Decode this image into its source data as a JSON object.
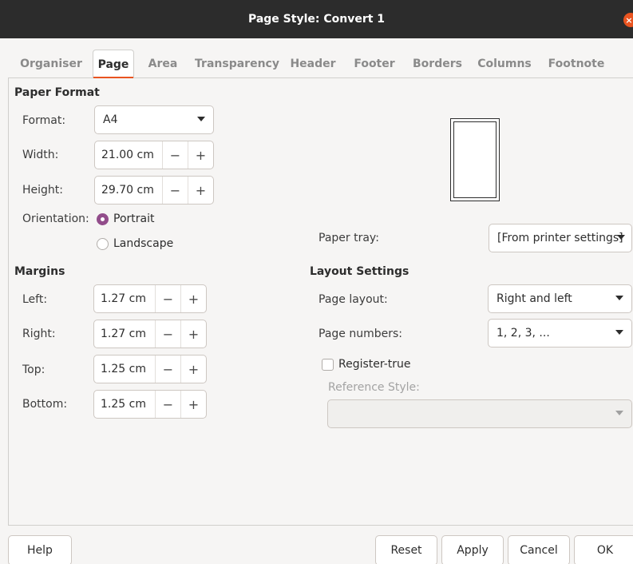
{
  "window": {
    "title": "Page Style: Convert 1",
    "close_glyph": "×"
  },
  "tabs": [
    {
      "label": "Organiser"
    },
    {
      "label": "Page"
    },
    {
      "label": "Area"
    },
    {
      "label": "Transparency"
    },
    {
      "label": "Header"
    },
    {
      "label": "Footer"
    },
    {
      "label": "Borders"
    },
    {
      "label": "Columns"
    },
    {
      "label": "Footnote"
    }
  ],
  "active_tab": "Page",
  "paper_format": {
    "title": "Paper Format",
    "format_label": "Format:",
    "format_value": "A4",
    "width_label": "Width:",
    "width_value": "21.00 cm",
    "height_label": "Height:",
    "height_value": "29.70 cm",
    "orientation_label": "Orientation:",
    "portrait_label": "Portrait",
    "landscape_label": "Landscape",
    "orientation_selected": "Portrait",
    "paper_tray_label": "Paper tray:",
    "paper_tray_value": "[From printer settings]"
  },
  "margins": {
    "title": "Margins",
    "left_label": "Left:",
    "left_value": "1.27 cm",
    "right_label": "Right:",
    "right_value": "1.27 cm",
    "top_label": "Top:",
    "top_value": "1.25 cm",
    "bottom_label": "Bottom:",
    "bottom_value": "1.25 cm"
  },
  "layout_settings": {
    "title": "Layout Settings",
    "page_layout_label": "Page layout:",
    "page_layout_value": "Right and left",
    "page_numbers_label": "Page numbers:",
    "page_numbers_value": "1, 2, 3, ...",
    "register_true_label": "Register-true",
    "register_true_checked": false,
    "reference_style_label": "Reference Style:",
    "reference_style_value": ""
  },
  "spin_glyphs": {
    "minus": "−",
    "plus": "+"
  },
  "buttons": {
    "help": "Help",
    "reset": "Reset",
    "apply": "Apply",
    "cancel": "Cancel",
    "ok": "OK"
  },
  "colors": {
    "accent": "#e95420",
    "radio_checked": "#924d8b",
    "titlebar": "#2c2c2c"
  }
}
